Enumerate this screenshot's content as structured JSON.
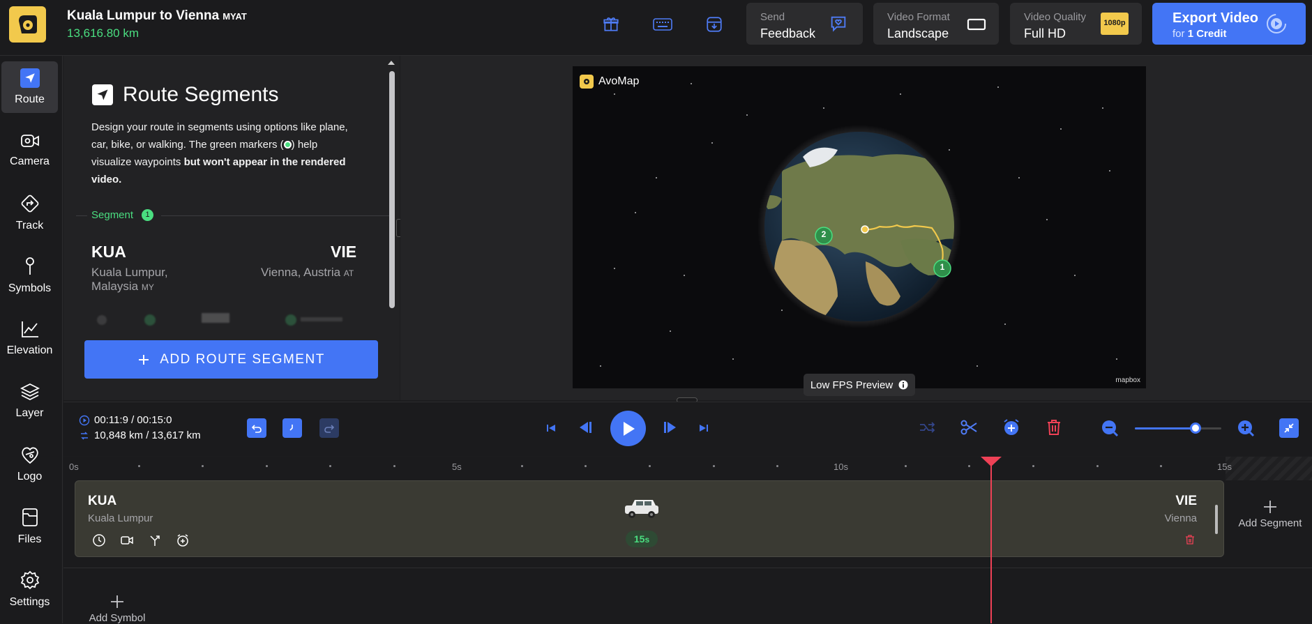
{
  "header": {
    "title": "Kuala Lumpur to Vienna",
    "title_suffix": "MYAT",
    "distance": "13,616.80 km",
    "feedback": {
      "label": "Send",
      "value": "Feedback"
    },
    "video_format": {
      "label": "Video Format",
      "value": "Landscape"
    },
    "video_quality": {
      "label": "Video Quality",
      "value": "Full HD",
      "badge": "1080p"
    },
    "export": {
      "title": "Export Video",
      "sub_prefix": "for",
      "credits": "1 Credit"
    }
  },
  "sidebar": {
    "items": [
      {
        "label": "Route",
        "icon": "navigation-arrow-icon"
      },
      {
        "label": "Camera",
        "icon": "camera-icon"
      },
      {
        "label": "Track",
        "icon": "track-icon"
      },
      {
        "label": "Symbols",
        "icon": "pin-icon"
      },
      {
        "label": "Elevation",
        "icon": "chart-icon"
      },
      {
        "label": "Layer",
        "icon": "layers-icon"
      },
      {
        "label": "Logo",
        "icon": "logo-icon"
      },
      {
        "label": "Files",
        "icon": "files-icon"
      },
      {
        "label": "Settings",
        "icon": "gear-icon"
      }
    ]
  },
  "panel": {
    "title": "Route Segments",
    "desc_1": "Design your route in segments using options like plane, car, bike, or walking. The green markers (",
    "desc_2": ") help visualize waypoints ",
    "desc_bold": "but won't appear in the rendered video.",
    "segment_label": "Segment",
    "segment_number": "1",
    "from_code": "KUA",
    "from_place": "Kuala Lumpur,",
    "from_place2": "Malaysia",
    "from_country": "MY",
    "to_code": "VIE",
    "to_place": "Vienna, Austria",
    "to_country": "AT",
    "add_route_label": "ADD ROUTE SEGMENT"
  },
  "preview": {
    "brand": "AvoMap",
    "marker_1": "1",
    "marker_2": "2",
    "attribution": "mapbox",
    "low_fps": "Low FPS Preview"
  },
  "controls": {
    "time": "00:11:9 / 00:15:0",
    "distance": "10,848 km / 13,617 km",
    "zoom_level": 0.7
  },
  "timeline": {
    "ruler_labels": [
      "0s",
      "5s",
      "10s",
      "15s"
    ],
    "segment": {
      "from_code": "KUA",
      "from_place": "Kuala Lumpur",
      "to_code": "VIE",
      "to_place": "Vienna",
      "duration": "15",
      "duration_unit": "s"
    },
    "add_segment": "Add Segment",
    "add_symbol": "Add Symbol"
  },
  "colors": {
    "accent": "#4375f5",
    "green": "#4ade80",
    "danger": "#ef4156",
    "logo": "#f2c94c"
  }
}
